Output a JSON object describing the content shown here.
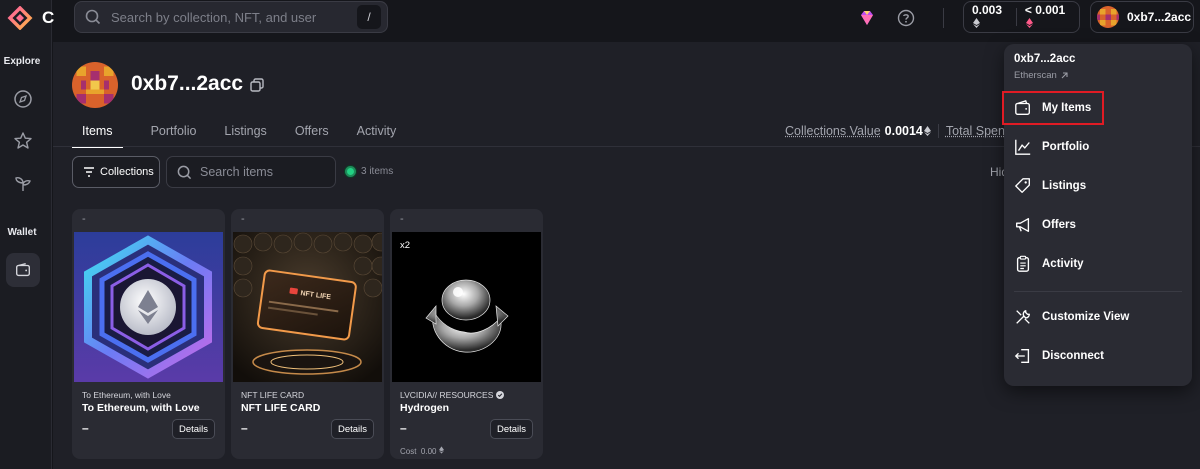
{
  "app": {
    "logo_letter": "C"
  },
  "rail": {
    "explore_label": "Explore",
    "wallet_label": "Wallet"
  },
  "search": {
    "placeholder": "Search by collection, NFT, and user",
    "shortcut": "/"
  },
  "balances": {
    "eth": "0.003",
    "weth": "< 0.001"
  },
  "account": {
    "short_address": "0xb7...2acc"
  },
  "profile": {
    "name": "0xb7...2acc"
  },
  "tabs": [
    "Items",
    "Portfolio",
    "Listings",
    "Offers",
    "Activity"
  ],
  "stats": {
    "collections_value_label": "Collections Value",
    "collections_value": "0.0014",
    "total_spent_label": "Total Spen"
  },
  "toolbar": {
    "collections_button": "Collections",
    "search_placeholder": "Search items",
    "item_count": "3 items",
    "hide_label": "Hid"
  },
  "cards": [
    {
      "top": "-",
      "collection": "To Ethereum, with Love",
      "name": "To Ethereum, with Love",
      "price": "–",
      "details": "Details"
    },
    {
      "top": "-",
      "collection": "NFT LIFE CARD",
      "name": "NFT LIFE CARD",
      "price": "–",
      "details": "Details",
      "card_text": "NFT LIFE"
    },
    {
      "top": "-",
      "collection": "LVCIDIA// RESOURCES",
      "name": "Hydrogen",
      "price": "–",
      "details": "Details",
      "quantity": "x2",
      "cost_label": "Cost",
      "cost_value": "0.00"
    }
  ],
  "menu": {
    "header": "0xb7...2acc",
    "etherscan": "Etherscan",
    "items": [
      {
        "label": "My Items",
        "icon": "wallet-icon"
      },
      {
        "label": "Portfolio",
        "icon": "chart-icon"
      },
      {
        "label": "Listings",
        "icon": "tag-icon"
      },
      {
        "label": "Offers",
        "icon": "megaphone-icon"
      },
      {
        "label": "Activity",
        "icon": "clipboard-icon"
      },
      {
        "label": "Customize View",
        "icon": "tools-icon"
      },
      {
        "label": "Disconnect",
        "icon": "logout-icon"
      }
    ]
  },
  "colors": {
    "background": "#15161b",
    "panel": "#1f2027",
    "card": "#2a2b33",
    "highlight_border": "#e01b24",
    "status_green": "#22d183"
  }
}
